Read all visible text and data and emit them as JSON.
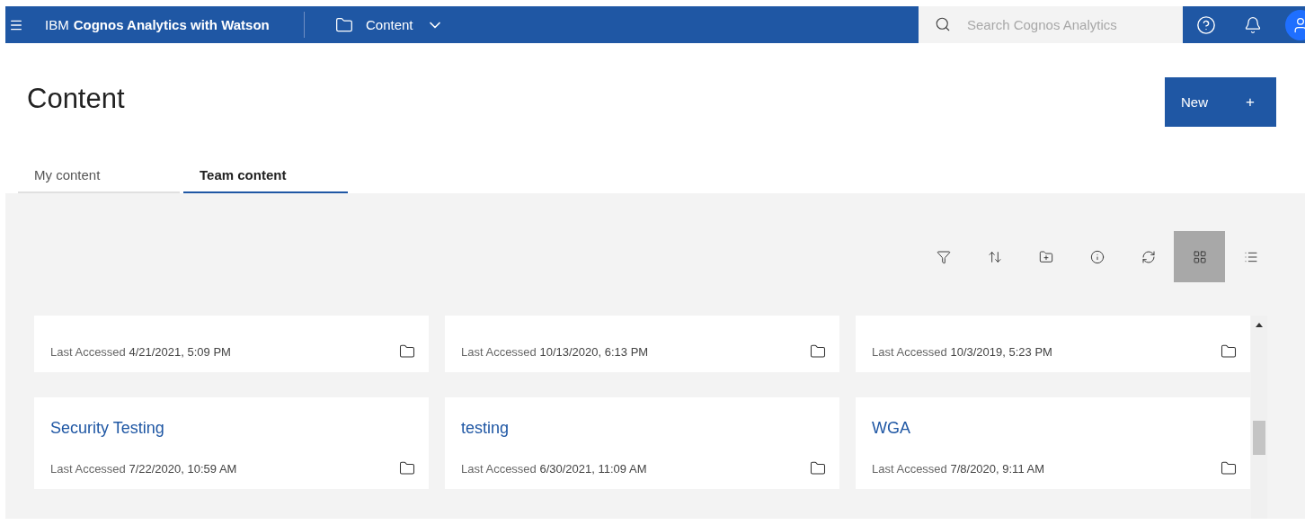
{
  "header": {
    "brand_prefix": "IBM",
    "brand_name": "Cognos Analytics with Watson",
    "location": "Content",
    "search": {
      "placeholder": "Search Cognos Analytics"
    }
  },
  "page": {
    "title": "Content",
    "new_button": "New",
    "new_button_icon": "+"
  },
  "tabs": [
    {
      "label": "My content",
      "selected": false
    },
    {
      "label": "Team content",
      "selected": true
    }
  ],
  "toolbar": [
    {
      "kind": "filter",
      "selected": false
    },
    {
      "kind": "sort",
      "selected": false
    },
    {
      "kind": "new-folder",
      "selected": false
    },
    {
      "kind": "info",
      "selected": false
    },
    {
      "kind": "refresh",
      "selected": false
    },
    {
      "kind": "grid",
      "selected": true
    },
    {
      "kind": "list",
      "selected": false
    }
  ],
  "cards": [
    {
      "label": "Last Accessed",
      "date": "4/21/2021, 5:09 PM"
    },
    {
      "label": "Last Accessed",
      "date": "10/13/2020, 6:13 PM"
    },
    {
      "label": "Last Accessed",
      "date": "10/3/2019, 5:23 PM"
    },
    {
      "title": "Security Testing",
      "label": "Last Accessed",
      "date": "7/22/2020, 10:59 AM"
    },
    {
      "title": "testing",
      "label": "Last Accessed",
      "date": "6/30/2021, 11:09 AM"
    },
    {
      "title": "WGA",
      "label": "Last Accessed",
      "date": "7/8/2020, 9:11 AM"
    }
  ]
}
